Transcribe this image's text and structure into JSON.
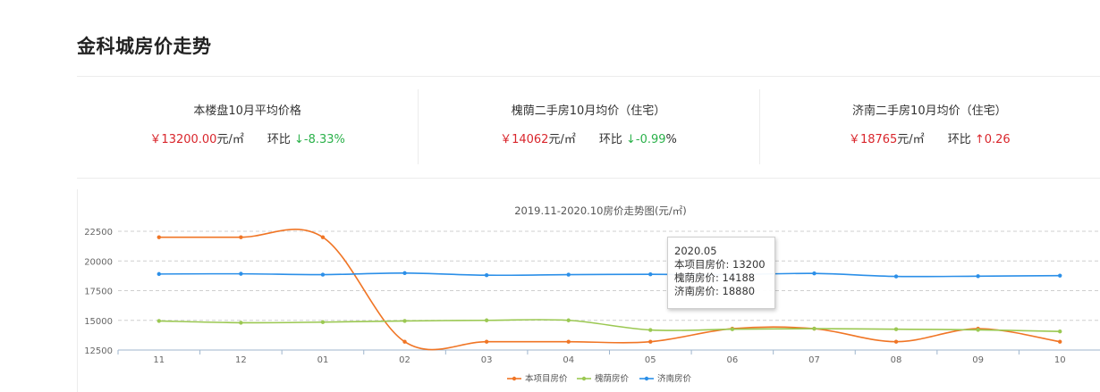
{
  "page": {
    "title": "金科城房价走势"
  },
  "stats": [
    {
      "label": "本楼盘10月平均价格",
      "currency": "￥",
      "price": "13200.00",
      "unit": "元/㎡",
      "hb_label": "环比",
      "arrow": "↓",
      "change": "-8.33%",
      "direction": "down"
    },
    {
      "label": "槐荫二手房10月均价（住宅）",
      "currency": "￥",
      "price": "14062",
      "unit": "元/㎡",
      "hb_label": "环比",
      "arrow": "↓",
      "change": "-0.99",
      "change_suffix": "%",
      "direction": "down"
    },
    {
      "label": "济南二手房10月均价（住宅）",
      "currency": "￥",
      "price": "18765",
      "unit": "元/㎡",
      "hb_label": "环比",
      "arrow": "↑",
      "change": "0.26",
      "direction": "up"
    }
  ],
  "colors": {
    "project": "#f07525",
    "huaiyin": "#9bc852",
    "jinan": "#2b8fe8",
    "price_red": "#d9262c",
    "down_green": "#2bb14a"
  },
  "tooltip": {
    "title": "2020.05",
    "rows": [
      "本项目房价: 13200",
      "槐荫房价: 14188",
      "济南房价: 18880"
    ]
  },
  "chart_data": {
    "type": "line",
    "title": "2019.11-2020.10房价走势图(元/㎡)",
    "categories": [
      "11",
      "12",
      "01",
      "02",
      "03",
      "04",
      "05",
      "06",
      "07",
      "08",
      "09",
      "10"
    ],
    "yticks": [
      12500,
      15000,
      17500,
      20000,
      22500
    ],
    "ylim": [
      12500,
      22500
    ],
    "grid": true,
    "legend_position": "bottom",
    "series": [
      {
        "name": "本项目房价",
        "color": "#f07525",
        "values": [
          22000,
          22000,
          22000,
          13200,
          13200,
          13200,
          13200,
          14300,
          14300,
          13200,
          14300,
          13200
        ]
      },
      {
        "name": "槐荫房价",
        "color": "#9bc852",
        "values": [
          14950,
          14800,
          14850,
          14950,
          15000,
          15000,
          14188,
          14250,
          14300,
          14250,
          14200,
          14062
        ]
      },
      {
        "name": "济南房价",
        "color": "#2b8fe8",
        "values": [
          18900,
          18920,
          18850,
          18980,
          18800,
          18850,
          18880,
          18850,
          18950,
          18700,
          18720,
          18765
        ]
      }
    ]
  }
}
